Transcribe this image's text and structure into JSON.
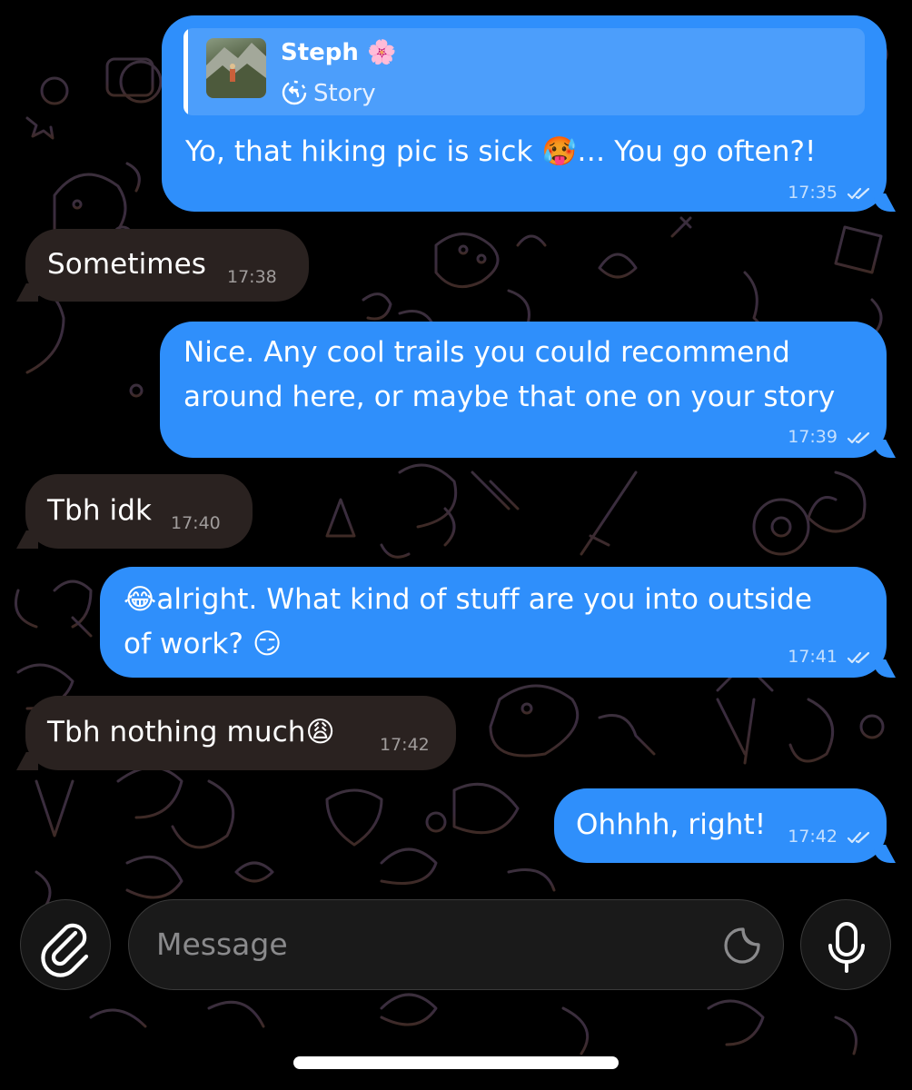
{
  "reply": {
    "name": "Steph",
    "name_emoji": "🌸",
    "kind": "Story"
  },
  "messages": [
    {
      "direction": "outgoing",
      "text": "Yo, that hiking pic is sick 🥵… You go often?!",
      "time": "17:35",
      "read": true
    },
    {
      "direction": "incoming",
      "text": "Sometimes",
      "time": "17:38"
    },
    {
      "direction": "outgoing",
      "lines": [
        "Nice. Any cool trails you could recommend",
        "around here, or maybe that one on your story"
      ],
      "time": "17:39",
      "read": true
    },
    {
      "direction": "incoming",
      "text": "Tbh idk",
      "time": "17:40"
    },
    {
      "direction": "outgoing",
      "lines": [
        "😂alright. What kind of stuff are you into outside",
        "of work? 😏"
      ],
      "time": "17:41",
      "read": true
    },
    {
      "direction": "incoming",
      "text": "Tbh nothing much😩",
      "time": "17:42"
    },
    {
      "direction": "outgoing",
      "text": "Ohhhh, right!",
      "time": "17:42",
      "read": true
    }
  ],
  "composer": {
    "placeholder": "Message"
  },
  "icons": {
    "attach": "paperclip-icon",
    "sticker": "sticker-icon",
    "mic": "microphone-icon",
    "reply": "story-reply-icon",
    "read": "double-check-icon"
  },
  "colors": {
    "outgoing_bubble": "#2f8ffb",
    "incoming_bubble": "#2a2220",
    "background": "#000000"
  }
}
